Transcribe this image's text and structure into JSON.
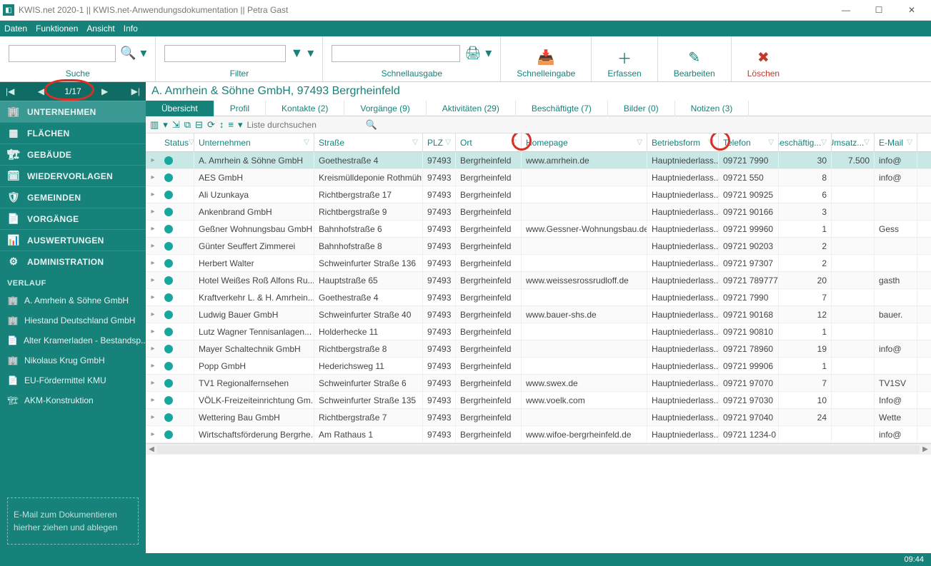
{
  "window": {
    "title": "KWIS.net 2020-1 || KWIS.net-Anwendungsdokumentation || Petra Gast",
    "min": "—",
    "max": "☐",
    "close": "✕"
  },
  "menubar": [
    "Daten",
    "Funktionen",
    "Ansicht",
    "Info"
  ],
  "toolbar": {
    "search_label": "Suche",
    "filter_label": "Filter",
    "quick_out_label": "Schnellausgabe",
    "quick_in_label": "Schnelleingabe",
    "create_label": "Erfassen",
    "edit_label": "Bearbeiten",
    "delete_label": "Löschen",
    "search_icon": "🔍",
    "filter_icon": "▼",
    "print_icon": "🖨",
    "quick_in_icon": "📥",
    "create_icon": "＋",
    "edit_icon": "✎",
    "delete_icon": "✖",
    "dropdown": "▾"
  },
  "pager": {
    "first": "|◀",
    "prev": "◀",
    "count": "1/17",
    "next": "▶",
    "last": "▶|"
  },
  "nav": {
    "items": [
      {
        "icon": "🏢",
        "label": "UNTERNEHMEN",
        "active": true
      },
      {
        "icon": "▦",
        "label": "FLÄCHEN"
      },
      {
        "icon": "🏗",
        "label": "GEBÄUDE"
      },
      {
        "icon": "🗓",
        "label": "WIEDERVORLAGEN"
      },
      {
        "icon": "🛡",
        "label": "GEMEINDEN"
      },
      {
        "icon": "📄",
        "label": "VORGÄNGE"
      },
      {
        "icon": "📊",
        "label": "AUSWERTUNGEN"
      },
      {
        "icon": "⚙",
        "label": "ADMINISTRATION"
      }
    ],
    "history_label": "VERLAUF",
    "history": [
      {
        "icon": "🏢",
        "label": "A. Amrhein & Söhne GmbH"
      },
      {
        "icon": "🏢",
        "label": "Hiestand Deutschland GmbH"
      },
      {
        "icon": "📄",
        "label": "Alter Kramerladen - Bestandsp..."
      },
      {
        "icon": "🏢",
        "label": "Nikolaus Krug GmbH"
      },
      {
        "icon": "📄",
        "label": "EU-Fördermittel KMU"
      },
      {
        "icon": "🏗",
        "label": "AKM-Konstruktion"
      }
    ],
    "dropzone_l1": "E-Mail  zum Dokumentieren",
    "dropzone_l2": "hierher ziehen und ablegen"
  },
  "record": {
    "title": "A. Amrhein & Söhne GmbH, 97493 Bergrheinfeld"
  },
  "tabs": [
    {
      "label": "Übersicht",
      "active": true
    },
    {
      "label": "Profil"
    },
    {
      "label": "Kontakte (2)"
    },
    {
      "label": "Vorgänge (9)"
    },
    {
      "label": "Aktivitäten (29)"
    },
    {
      "label": "Beschäftigte (7)"
    },
    {
      "label": "Bilder (0)"
    },
    {
      "label": "Notizen (3)"
    }
  ],
  "gridbar": {
    "placeholder": "Liste durchsuchen",
    "search_icon": "🔍"
  },
  "columns": [
    "Status",
    "Unternehmen",
    "Straße",
    "PLZ",
    "Ort",
    "Homepage",
    "Betriebsform",
    "Telefon",
    "Beschäftig...",
    "Umsatz...",
    "E-Mail"
  ],
  "rows": [
    {
      "sel": true,
      "u": "A. Amrhein & Söhne GmbH",
      "s": "Goethestraße 4",
      "p": "97493",
      "o": "Bergrheinfeld",
      "h": "www.amrhein.de",
      "f": "Hauptniederlass...",
      "t": "09721 7990",
      "b": "30",
      "um": "7.500",
      "m": "info@"
    },
    {
      "u": "AES GmbH",
      "s": "Kreismülldeponie  Rothmüh...",
      "p": "97493",
      "o": "Bergrheinfeld",
      "h": "",
      "f": "Hauptniederlass...",
      "t": "09721 550",
      "b": "8",
      "um": "",
      "m": "info@"
    },
    {
      "u": "Ali Uzunkaya",
      "s": "Richtbergstraße 17",
      "p": "97493",
      "o": "Bergrheinfeld",
      "h": "",
      "f": "Hauptniederlass...",
      "t": "09721 90925",
      "b": "6",
      "um": "",
      "m": ""
    },
    {
      "u": "Ankenbrand GmbH",
      "s": "Richtbergstraße 9",
      "p": "97493",
      "o": "Bergrheinfeld",
      "h": "",
      "f": "Hauptniederlass...",
      "t": "09721 90166",
      "b": "3",
      "um": "",
      "m": ""
    },
    {
      "u": "Geßner Wohnungsbau GmbH",
      "s": "Bahnhofstraße 6",
      "p": "97493",
      "o": "Bergrheinfeld",
      "h": "www.Gessner-Wohnungsbau.de",
      "f": "Hauptniederlass...",
      "t": "09721 99960",
      "b": "1",
      "um": "",
      "m": "Gess"
    },
    {
      "u": "Günter Seuffert Zimmerei",
      "s": "Bahnhofstraße 8",
      "p": "97493",
      "o": "Bergrheinfeld",
      "h": "",
      "f": "Hauptniederlass...",
      "t": "09721 90203",
      "b": "2",
      "um": "",
      "m": ""
    },
    {
      "u": "Herbert Walter",
      "s": "Schweinfurter Straße 136",
      "p": "97493",
      "o": "Bergrheinfeld",
      "h": "",
      "f": "Hauptniederlass...",
      "t": "09721 97307",
      "b": "2",
      "um": "",
      "m": ""
    },
    {
      "u": "Hotel Weißes Roß Alfons Ru...",
      "s": "Hauptstraße 65",
      "p": "97493",
      "o": "Bergrheinfeld",
      "h": "www.weissesrossrudloff.de",
      "f": "Hauptniederlass...",
      "t": "09721 789777",
      "b": "20",
      "um": "",
      "m": "gasth"
    },
    {
      "u": "Kraftverkehr L. & H. Amrhein...",
      "s": "Goethestraße 4",
      "p": "97493",
      "o": "Bergrheinfeld",
      "h": "",
      "f": "Hauptniederlass...",
      "t": "09721 7990",
      "b": "7",
      "um": "",
      "m": ""
    },
    {
      "u": "Ludwig Bauer GmbH",
      "s": "Schweinfurter Straße 40",
      "p": "97493",
      "o": "Bergrheinfeld",
      "h": "www.bauer-shs.de",
      "f": "Hauptniederlass...",
      "t": "09721 90168",
      "b": "12",
      "um": "",
      "m": "bauer."
    },
    {
      "u": "Lutz Wagner Tennisanlagen...",
      "s": "Holderhecke 11",
      "p": "97493",
      "o": "Bergrheinfeld",
      "h": "",
      "f": "Hauptniederlass...",
      "t": "09721 90810",
      "b": "1",
      "um": "",
      "m": ""
    },
    {
      "u": "Mayer Schaltechnik GmbH",
      "s": "Richtbergstraße 8",
      "p": "97493",
      "o": "Bergrheinfeld",
      "h": "",
      "f": "Hauptniederlass...",
      "t": "09721 78960",
      "b": "19",
      "um": "",
      "m": "info@"
    },
    {
      "u": "Popp GmbH",
      "s": "Hederichsweg 11",
      "p": "97493",
      "o": "Bergrheinfeld",
      "h": "",
      "f": "Hauptniederlass...",
      "t": "09721 99906",
      "b": "1",
      "um": "",
      "m": ""
    },
    {
      "u": "TV1 Regionalfernsehen",
      "s": "Schweinfurter Straße 6",
      "p": "97493",
      "o": "Bergrheinfeld",
      "h": "www.swex.de",
      "f": "Hauptniederlass...",
      "t": "09721 97070",
      "b": "7",
      "um": "",
      "m": "TV1SV"
    },
    {
      "u": "VÖLK-Freizeiteinrichtung Gm...",
      "s": "Schweinfurter Straße 135",
      "p": "97493",
      "o": "Bergrheinfeld",
      "h": "www.voelk.com",
      "f": "Hauptniederlass...",
      "t": "09721 97030",
      "b": "10",
      "um": "",
      "m": "Info@"
    },
    {
      "u": "Wettering Bau GmbH",
      "s": "Richtbergstraße 7",
      "p": "97493",
      "o": "Bergrheinfeld",
      "h": "",
      "f": "Hauptniederlass...",
      "t": "09721 97040",
      "b": "24",
      "um": "",
      "m": "Wette"
    },
    {
      "u": "Wirtschaftsförderung  Bergrhe...",
      "s": "Am Rathaus 1",
      "p": "97493",
      "o": "Bergrheinfeld",
      "h": "www.wifoe-bergrheinfeld.de",
      "f": "Hauptniederlass...",
      "t": "09721 1234-0",
      "b": "",
      "um": "",
      "m": "info@"
    }
  ],
  "statusbar": {
    "time": "09:44"
  }
}
